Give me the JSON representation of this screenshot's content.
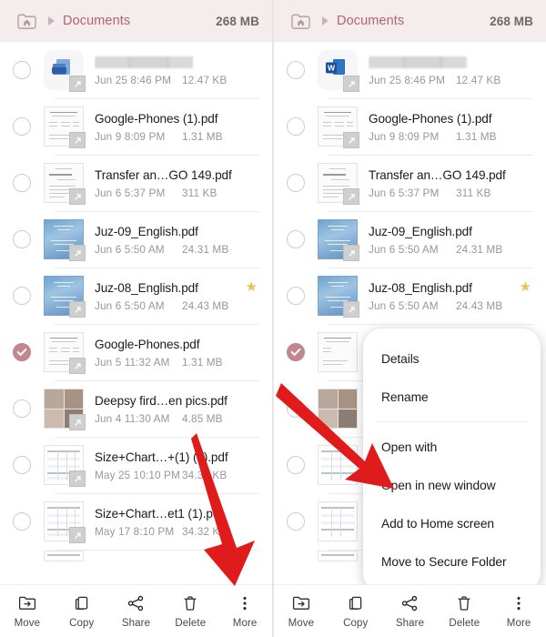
{
  "app": {
    "header": {
      "home_icon": "home-folder-icon",
      "separator_icon": "chevron-right-icon",
      "breadcrumb": "Documents",
      "storage_size": "268 MB"
    },
    "bottom_bar": [
      {
        "label": "Move",
        "icon": "move-to-folder-icon"
      },
      {
        "label": "Copy",
        "icon": "copy-icon"
      },
      {
        "label": "Share",
        "icon": "share-icon"
      },
      {
        "label": "Delete",
        "icon": "trash-icon"
      },
      {
        "label": "More",
        "icon": "more-vertical-icon"
      }
    ]
  },
  "files": [
    {
      "name": "",
      "redacted": true,
      "date": "Jun 25 8:46 PM",
      "size": "12.47 KB",
      "selected": false,
      "starred": false,
      "thumb": "app-doc"
    },
    {
      "name": "Google-Phones (1).pdf",
      "redacted": false,
      "date": "Jun 9 8:09 PM",
      "size": "1.31 MB",
      "selected": false,
      "starred": false,
      "thumb": "text-doc"
    },
    {
      "name": "Transfer an…GO 149.pdf",
      "redacted": false,
      "date": "Jun 6 5:37 PM",
      "size": "311 KB",
      "selected": false,
      "starred": false,
      "thumb": "text-doc"
    },
    {
      "name": "Juz-09_English.pdf",
      "redacted": false,
      "date": "Jun 6 5:50 AM",
      "size": "24.31 MB",
      "selected": false,
      "starred": false,
      "thumb": "blue-cover"
    },
    {
      "name": "Juz-08_English.pdf",
      "redacted": false,
      "date": "Jun 6 5:50 AM",
      "size": "24.43 MB",
      "selected": false,
      "starred": true,
      "thumb": "blue-cover"
    },
    {
      "name": "Google-Phones.pdf",
      "redacted": false,
      "date": "Jun 5 11:32 AM",
      "size": "1.31 MB",
      "selected": true,
      "starred": false,
      "thumb": "text-doc"
    },
    {
      "name": "Deepsy fird…en pics.pdf",
      "redacted": false,
      "date": "Jun 4 11:30 AM",
      "size": "4.85 MB",
      "selected": false,
      "starred": false,
      "thumb": "photo-grid"
    },
    {
      "name": "Size+Chart…+(1) (1).pdf",
      "redacted": false,
      "date": "May 25 10:10 PM",
      "size": "34.32 KB",
      "selected": false,
      "starred": false,
      "thumb": "table-doc"
    },
    {
      "name": "Size+Chart…et1 (1).pdf",
      "redacted": false,
      "date": "May 17 8:10 PM",
      "size": "34.32 KB",
      "selected": false,
      "starred": false,
      "thumb": "table-doc"
    }
  ],
  "context_menu": {
    "items": [
      {
        "label": "Details"
      },
      {
        "label": "Rename"
      },
      {
        "label": "Open with"
      },
      {
        "label": "Open in new window"
      },
      {
        "label": "Add to Home screen"
      },
      {
        "label": "Move to Secure Folder"
      }
    ],
    "divider_after_index": 1
  },
  "annotations": {
    "left_arrow_target": "More",
    "right_arrow_target": "Add to Home screen",
    "arrow_color": "#e01b1b"
  },
  "colors": {
    "header_bg": "#f5eced",
    "breadcrumb_text": "#b4636f",
    "selected_checkbox": "#c2868f",
    "star": "#e9c34c",
    "arrow_red": "#e01b1b"
  }
}
